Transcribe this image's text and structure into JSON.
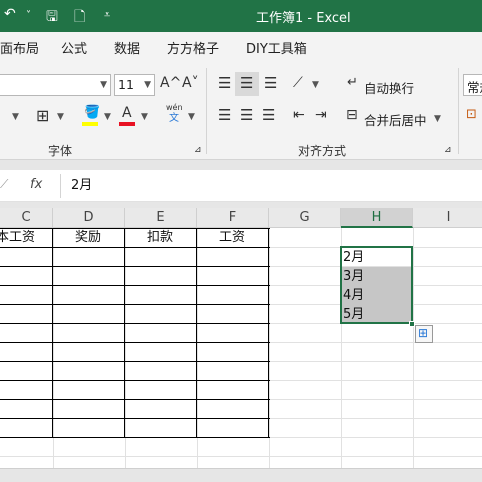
{
  "titlebar": {
    "title": "工作簿1  -  Excel"
  },
  "tabs": [
    "面布局",
    "公式",
    "数据",
    "方方格子",
    "DIY工具箱"
  ],
  "ribbon": {
    "font_size": "11",
    "grow_label": "A^",
    "shrink_label": "A˅",
    "phonetic_top": "wén",
    "phonetic_bottom": "文",
    "wrap_text": "自动换行",
    "merge_center": "合并后居中",
    "number_format": "常规",
    "group_font": "字体",
    "group_align": "对齐方式"
  },
  "formula_bar": {
    "fx": "fx",
    "value": "2月"
  },
  "columns": [
    "C",
    "D",
    "E",
    "F",
    "G",
    "H",
    "I"
  ],
  "table_headers": [
    "本工资",
    "奖励",
    "扣款",
    "工资"
  ],
  "h_cells": [
    "2月",
    "3月",
    "4月",
    "5月"
  ],
  "colors": {
    "excel_green": "#217346",
    "selection_shade": "#c6c6c6"
  }
}
